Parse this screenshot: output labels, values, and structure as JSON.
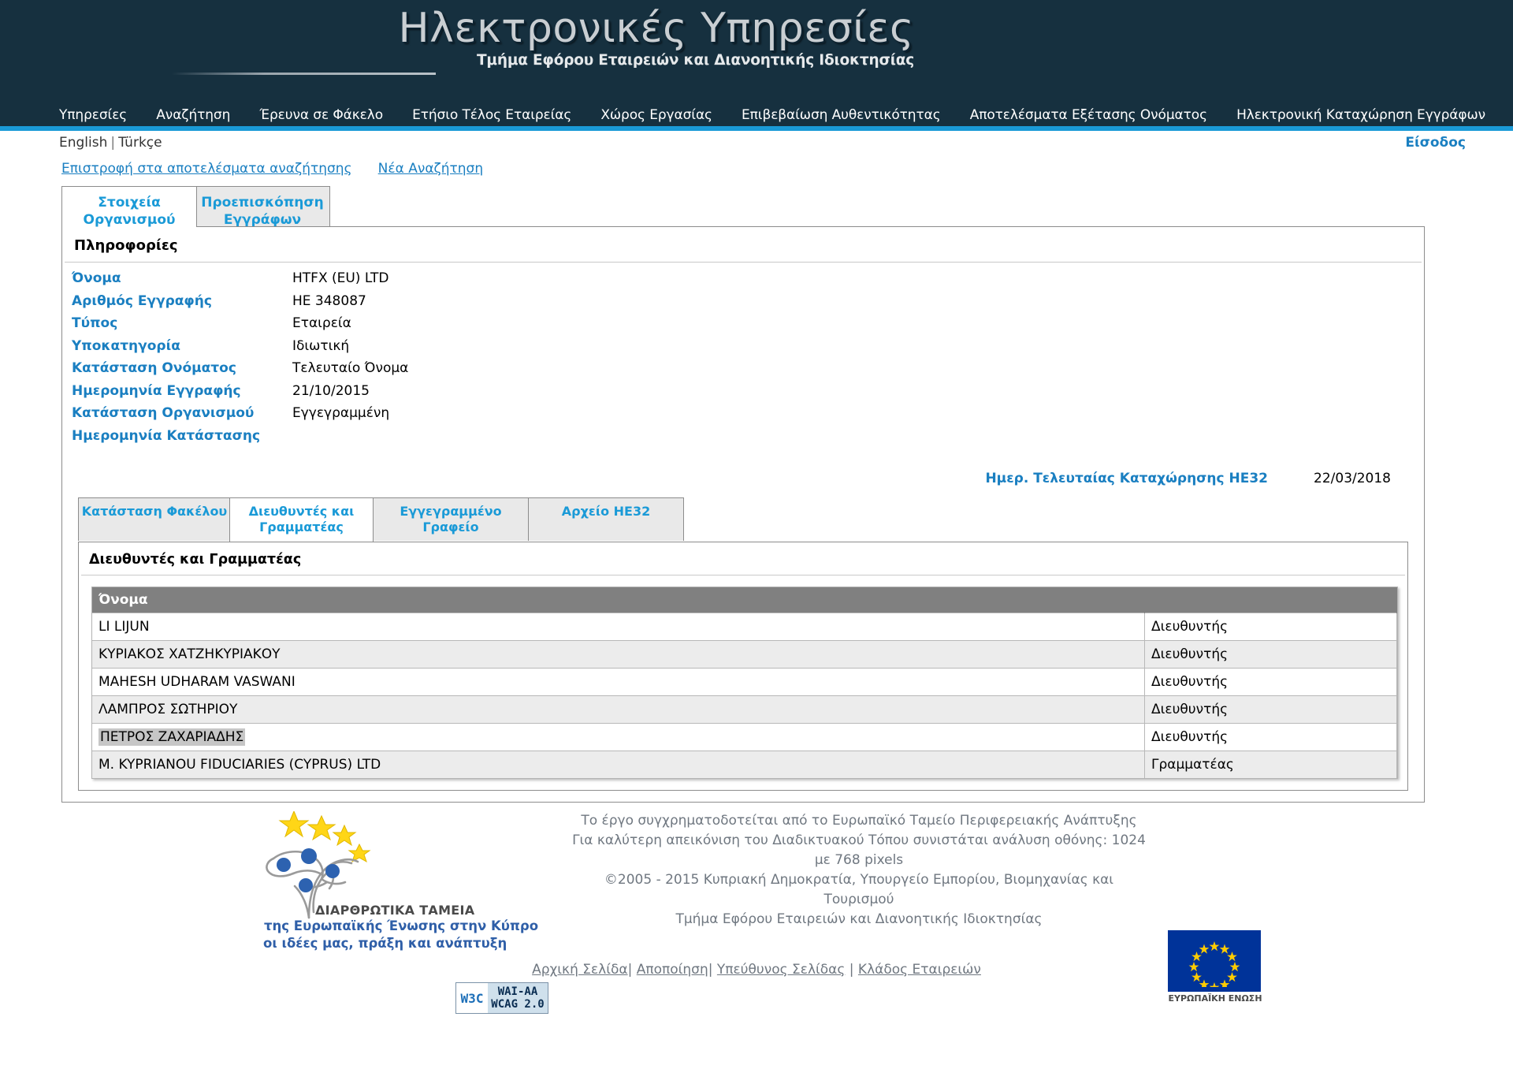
{
  "header": {
    "title": "Ηλεκτρονικές Υπηρεσίες",
    "subtitle": "Τμήμα Εφόρου Εταιρειών και Διανοητικής Ιδιοκτησίας",
    "nav": [
      {
        "label": "Υπηρεσίες"
      },
      {
        "label": "Αναζήτηση"
      },
      {
        "label": "Έρευνα σε Φάκελο"
      },
      {
        "label": "Ετήσιο Τέλος Εταιρείας"
      },
      {
        "label": "Χώρος Εργασίας"
      },
      {
        "label": "Επιβεβαίωση Αυθεντικότητας"
      },
      {
        "label": "Αποτελέσματα Εξέτασης Ονόματος"
      },
      {
        "label": "Ηλεκτρονική Καταχώρηση Εγγράφων"
      }
    ],
    "accent_color": "#1a9ad7",
    "background_color": "#16303f"
  },
  "langbar": {
    "english": "English",
    "separator": "|",
    "turkish": "Türkçe",
    "login": "Είσοδος"
  },
  "topsearch": {
    "back_to_results": "Επιστροφή στα αποτελέσματα αναζήτησης",
    "new_search": "Νέα Αναζήτηση"
  },
  "outer_tabs": [
    {
      "label": "Στοιχεία Οργανισμού",
      "active": true
    },
    {
      "label": "Προεπισκόπηση Εγγράφων Φακέλου",
      "active": false
    }
  ],
  "info_panel": {
    "heading": "Πληροφορίες",
    "rows": [
      {
        "label": "Όνομα",
        "value": "HTFX (EU) LTD"
      },
      {
        "label": "Αριθμός Εγγραφής",
        "value": "ΗΕ 348087"
      },
      {
        "label": "Τύπος",
        "value": "Εταιρεία"
      },
      {
        "label": "Υποκατηγορία",
        "value": "Ιδιωτική"
      },
      {
        "label": "Κατάσταση Ονόματος",
        "value": "Τελευταίο Όνομα"
      },
      {
        "label": "Ημερομηνία Εγγραφής",
        "value": "21/10/2015"
      },
      {
        "label": "Κατάσταση Οργανισμού",
        "value": "Εγγεγραμμένη"
      },
      {
        "label": "Ημερομηνία Κατάστασης",
        "value": ""
      }
    ],
    "he32_label": "Ημερ. Τελευταίας Καταχώρησης ΗΕ32",
    "he32_value": "22/03/2018"
  },
  "inner_tabs": [
    {
      "label": "Κατάσταση Φακέλου",
      "active": false
    },
    {
      "label": "Διευθυντές και Γραμματέας",
      "active": true
    },
    {
      "label": "Εγγεγραμμένο Γραφείο",
      "active": false
    },
    {
      "label": "Αρχείο ΗΕ32",
      "active": false
    }
  ],
  "directors_panel": {
    "heading": "Διευθυντές και Γραμματέας",
    "columns": [
      "Όνομα",
      ""
    ],
    "rows": [
      {
        "name": "LI LIJUN",
        "role": "Διευθυντής",
        "selected": false
      },
      {
        "name": "ΚΥΡΙΑΚΟΣ ΧΑΤΖΗΚΥΡΙΑΚΟΥ",
        "role": "Διευθυντής",
        "selected": false
      },
      {
        "name": "MAHESH UDHARAM VASWANI",
        "role": "Διευθυντής",
        "selected": false
      },
      {
        "name": "ΛΑΜΠΡΟΣ ΣΩΤΗΡΙΟΥ",
        "role": "Διευθυντής",
        "selected": false
      },
      {
        "name": "ΠΕΤΡΟΣ ΖΑΧΑΡΙΑΔΗΣ",
        "role": "Διευθυντής",
        "selected": true
      },
      {
        "name": "M. KYPRIANOU FIDUCIARIES (CYPRUS) LTD",
        "role": "Γραμματέας",
        "selected": false
      }
    ]
  },
  "footer": {
    "sf_logo": {
      "caption1": "ΔΙΑΡΘΡΩΤΙΚΑ ΤΑΜΕΙΑ",
      "caption2": "της Ευρωπαϊκής Ένωσης στην Κύπρο",
      "caption3": "οι ιδέες μας, πράξη και ανάπτυξη"
    },
    "wai_badge": {
      "w3c": "W3C",
      "line1": "WAI-AA",
      "line2": "WCAG 2.0"
    },
    "text_lines": [
      "Το έργο συγχρηματοδοτείται από το Ευρωπαϊκό Ταμείο Περιφερειακής Ανάπτυξης",
      "Για καλύτερη απεικόνιση του Διαδικτυακού Τόπου συνιστάται ανάλυση οθόνης: 1024",
      "με 768 pixels",
      "©2005 - 2015 Κυπριακή Δημοκρατία, Υπουργείο Εμπορίου, Βιομηχανίας και",
      "Τουρισμού",
      "Τμήμα Εφόρου Εταιρειών και Διανοητικής Ιδιοκτησίας"
    ],
    "links": [
      {
        "label": "Αρχική Σελίδα"
      },
      {
        "label": "Αποποίηση"
      },
      {
        "label": "Υπεύθυνος Σελίδας"
      },
      {
        "label": "Κλάδος Εταιρειών"
      }
    ],
    "eu_flag_caption": "ΕΥΡΩΠΑΪΚΗ ΕΝΩΣΗ"
  }
}
